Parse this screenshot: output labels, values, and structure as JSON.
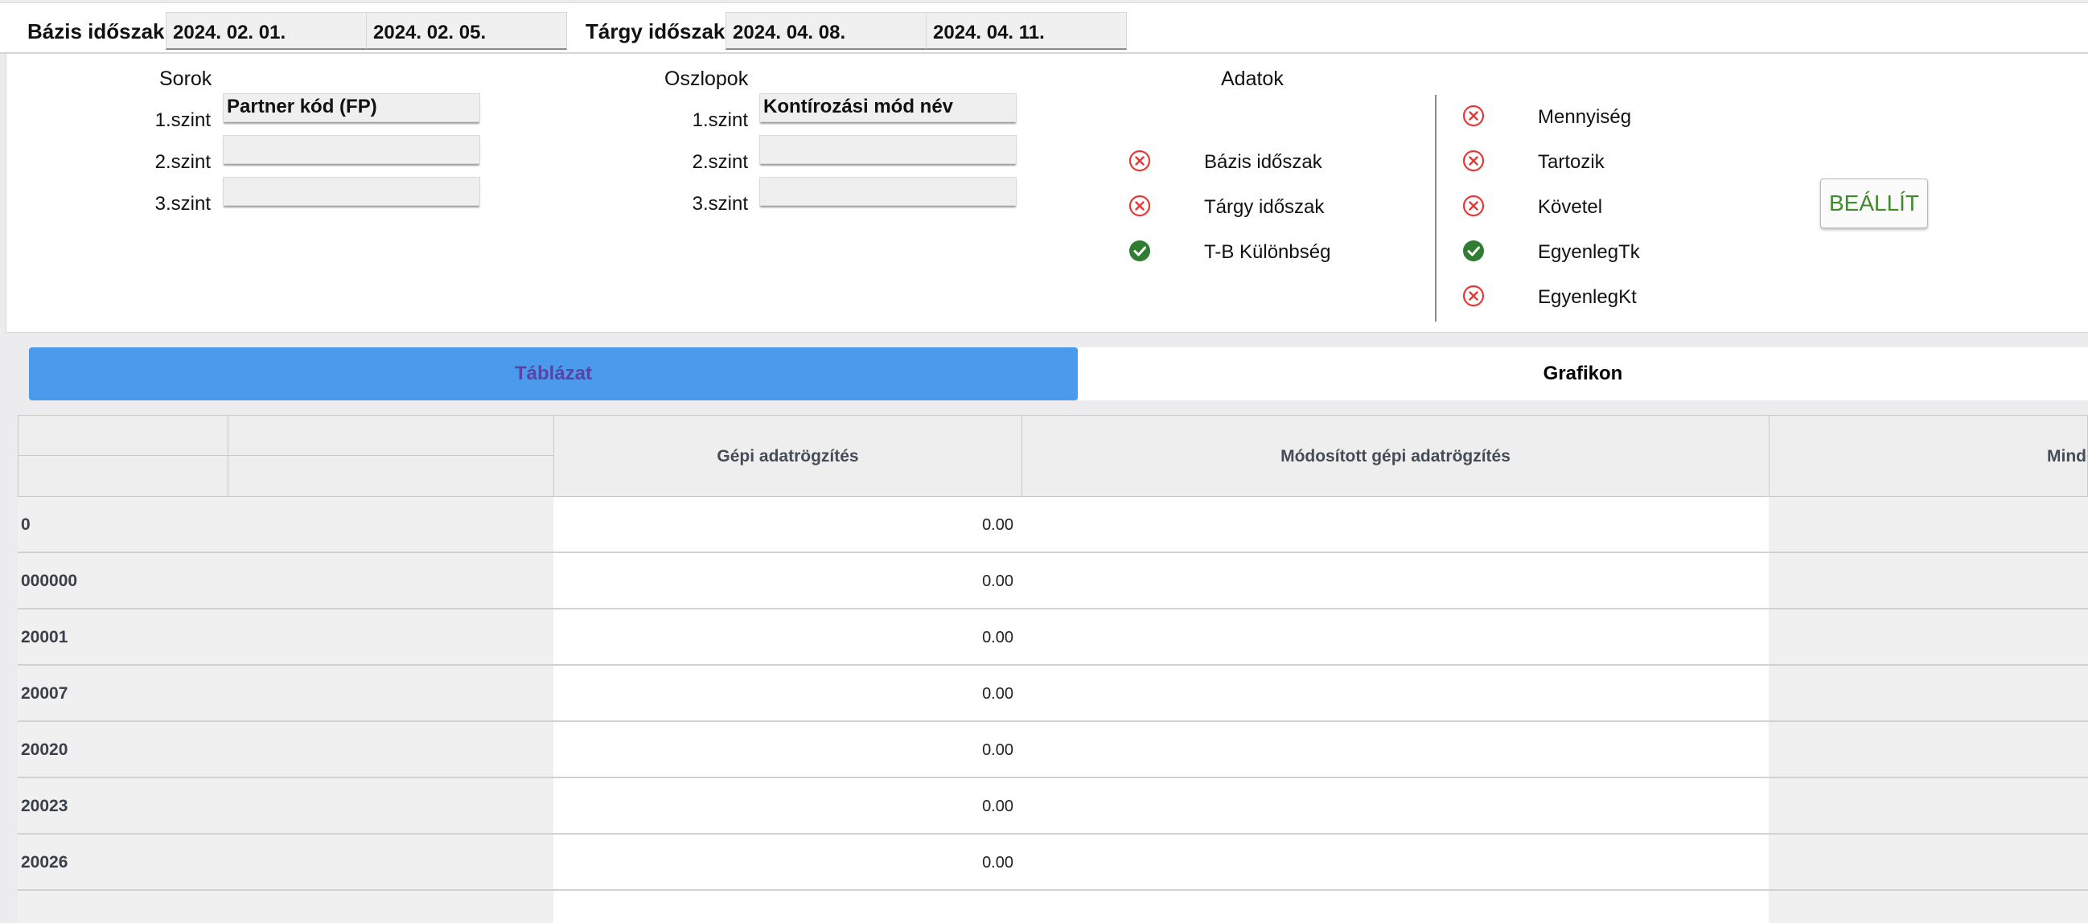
{
  "periods": {
    "base_label": "Bázis időszak",
    "base_from": "2024. 02. 01.",
    "base_to": "2024. 02. 05.",
    "subject_label": "Tárgy időszak",
    "subject_from": "2024. 04. 08.",
    "subject_to": "2024. 04. 11."
  },
  "rows_config": {
    "title": "Sorok",
    "levels": [
      {
        "label": "1.szint",
        "value": "Partner kód (FP)"
      },
      {
        "label": "2.szint",
        "value": ""
      },
      {
        "label": "3.szint",
        "value": ""
      }
    ]
  },
  "columns_config": {
    "title": "Oszlopok",
    "levels": [
      {
        "label": "1.szint",
        "value": "Kontírozási mód név"
      },
      {
        "label": "2.szint",
        "value": ""
      },
      {
        "label": "3.szint",
        "value": ""
      }
    ]
  },
  "data_config": {
    "title": "Adatok",
    "left": [
      {
        "label": "Bázis időszak",
        "enabled": false
      },
      {
        "label": "Tárgy időszak",
        "enabled": false
      },
      {
        "label": "T-B Különbség",
        "enabled": true
      }
    ],
    "right": [
      {
        "label": "Mennyiség",
        "enabled": false
      },
      {
        "label": "Tartozik",
        "enabled": false
      },
      {
        "label": "Követel",
        "enabled": false
      },
      {
        "label": "EgyenlegTk",
        "enabled": true
      },
      {
        "label": "EgyenlegKt",
        "enabled": false
      }
    ],
    "icons": {
      "enabled": "check-circle-icon",
      "disabled": "x-circle-icon"
    },
    "colors": {
      "enabled": "#2e7d32",
      "disabled": "#e53935"
    }
  },
  "set_button": "BEÁLLÍT",
  "tabs": {
    "table": "Táblázat",
    "chart": "Grafikon"
  },
  "grid": {
    "columns": [
      "Gépi adatrögzítés",
      "Módosított gépi adatrögzítés",
      "Mindös"
    ],
    "rows": [
      {
        "key": "0",
        "value": "0.00"
      },
      {
        "key": "000000",
        "value": "0.00"
      },
      {
        "key": "20001",
        "value": "0.00"
      },
      {
        "key": "20007",
        "value": "0.00"
      },
      {
        "key": "20020",
        "value": "0.00"
      },
      {
        "key": "20023",
        "value": "0.00"
      },
      {
        "key": "20026",
        "value": "0.00"
      }
    ]
  },
  "colors": {
    "accent_tab": "#4a9bec",
    "tab_text": "#5a43a6",
    "button_text": "#3f8a2b"
  }
}
